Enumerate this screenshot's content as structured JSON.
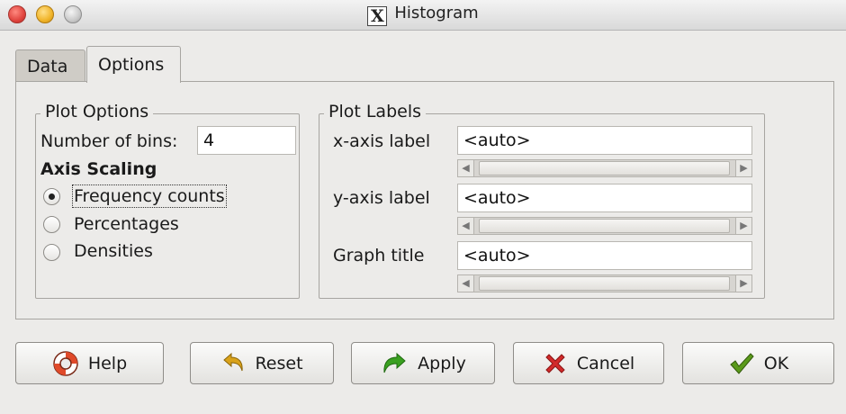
{
  "window": {
    "title": "Histogram",
    "app_icon": "x-window-icon"
  },
  "tabs": [
    {
      "label": "Data",
      "selected": false
    },
    {
      "label": "Options",
      "selected": true
    }
  ],
  "plot_options": {
    "frame_title": "Plot Options",
    "bins_label": "Number of bins:",
    "bins_value": "4",
    "scaling_heading": "Axis Scaling",
    "radios": [
      {
        "label": "Frequency counts",
        "checked": true
      },
      {
        "label": "Percentages",
        "checked": false
      },
      {
        "label": "Densities",
        "checked": false
      }
    ]
  },
  "plot_labels": {
    "frame_title": "Plot Labels",
    "fields": [
      {
        "label": "x-axis label",
        "value": "<auto>"
      },
      {
        "label": "y-axis label",
        "value": "<auto>"
      },
      {
        "label": "Graph title",
        "value": "<auto>"
      }
    ]
  },
  "buttons": {
    "help": "Help",
    "reset": "Reset",
    "apply": "Apply",
    "cancel": "Cancel",
    "ok": "OK"
  },
  "colors": {
    "window_bg": "#ecebe9",
    "apply_icon": "#3aa020",
    "cancel_icon": "#d22b2b",
    "ok_icon": "#5a9a1a",
    "reset_icon": "#d9a21a",
    "help_icon": "#e04a2a"
  }
}
